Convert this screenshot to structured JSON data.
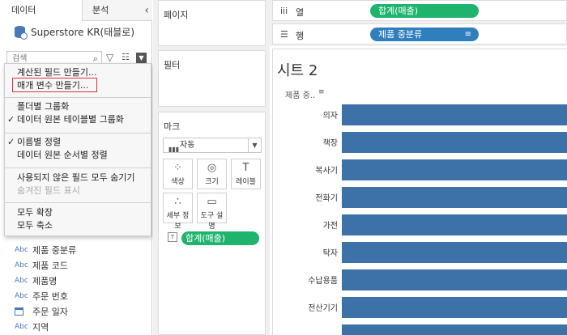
{
  "left": {
    "tabs": {
      "data": "데이터",
      "analysis": "분석"
    },
    "collapse_icon": "chevron-left-icon",
    "datasource": "Superstore KR(태블로)",
    "search_placeholder": "검색",
    "fields": [
      {
        "type": "Abc",
        "name": "제품 중분류"
      },
      {
        "type": "Abc",
        "name": "제품 코드"
      },
      {
        "type": "Abc",
        "name": "제품명"
      },
      {
        "type": "Abc",
        "name": "주문 번호"
      },
      {
        "type": "date",
        "name": "주문 일자"
      },
      {
        "type": "Abc",
        "name": "지역"
      }
    ]
  },
  "menu": {
    "items": [
      {
        "label": "계산된 필드 만들기...",
        "checked": false,
        "disabled": false
      },
      {
        "label": "매개 변수 만들기...",
        "checked": false,
        "disabled": false,
        "highlighted": true
      },
      {
        "label": "폴더별 그룹화",
        "checked": false,
        "disabled": false
      },
      {
        "label": "데이터 원본 테이블별 그룹화",
        "checked": true,
        "disabled": false
      },
      {
        "label": "이름별 정렬",
        "checked": true,
        "disabled": false
      },
      {
        "label": "데이터 원본 순서별 정렬",
        "checked": false,
        "disabled": false
      },
      {
        "label": "사용되지 않은 필드 모두 숨기기",
        "checked": false,
        "disabled": false
      },
      {
        "label": "숨겨진 필드 표시",
        "checked": false,
        "disabled": true
      },
      {
        "label": "모두 확장",
        "checked": false,
        "disabled": false
      },
      {
        "label": "모두 축소",
        "checked": false,
        "disabled": false
      }
    ],
    "check_glyph": "✓",
    "highlight_color": "#e0303a"
  },
  "cards": {
    "pages": "페이지",
    "filters": "필터",
    "marks": "마크",
    "mark_type": "자동",
    "mark_buttons": [
      {
        "icon": "color-dots-icon",
        "glyph": "⁘",
        "label": "색상"
      },
      {
        "icon": "size-icon",
        "glyph": "◎",
        "label": "크기"
      },
      {
        "icon": "label-icon",
        "glyph": "T",
        "label": "레이블"
      },
      {
        "icon": "detail-icon",
        "glyph": "∴",
        "label": "세부 정보"
      },
      {
        "icon": "tooltip-icon",
        "glyph": "▭",
        "label": "도구 설명"
      }
    ],
    "mark_pill": "합계(매출)",
    "mark_pill_icon": "T"
  },
  "shelves": {
    "columns_label": "열",
    "columns_icon": "iii",
    "columns_pill": "합계(매출)",
    "rows_label": "행",
    "rows_icon": "☰",
    "rows_pill": "제품 중분류"
  },
  "view": {
    "title": "시트 2",
    "row_header": "제품 중..",
    "bar_color": "#3d72a8"
  },
  "chart_data": {
    "type": "bar",
    "orientation": "horizontal",
    "categories": [
      "의자",
      "책장",
      "복사기",
      "전화기",
      "가전",
      "탁자",
      "수납용품",
      "전산기기",
      "..."
    ],
    "values": [
      1,
      1,
      1,
      1,
      1,
      1,
      1,
      1,
      1
    ],
    "bars_cropped_at_right_edge": true
  },
  "colors": {
    "green_pill": "#1fb46e",
    "blue_pill": "#2f7fbf"
  }
}
